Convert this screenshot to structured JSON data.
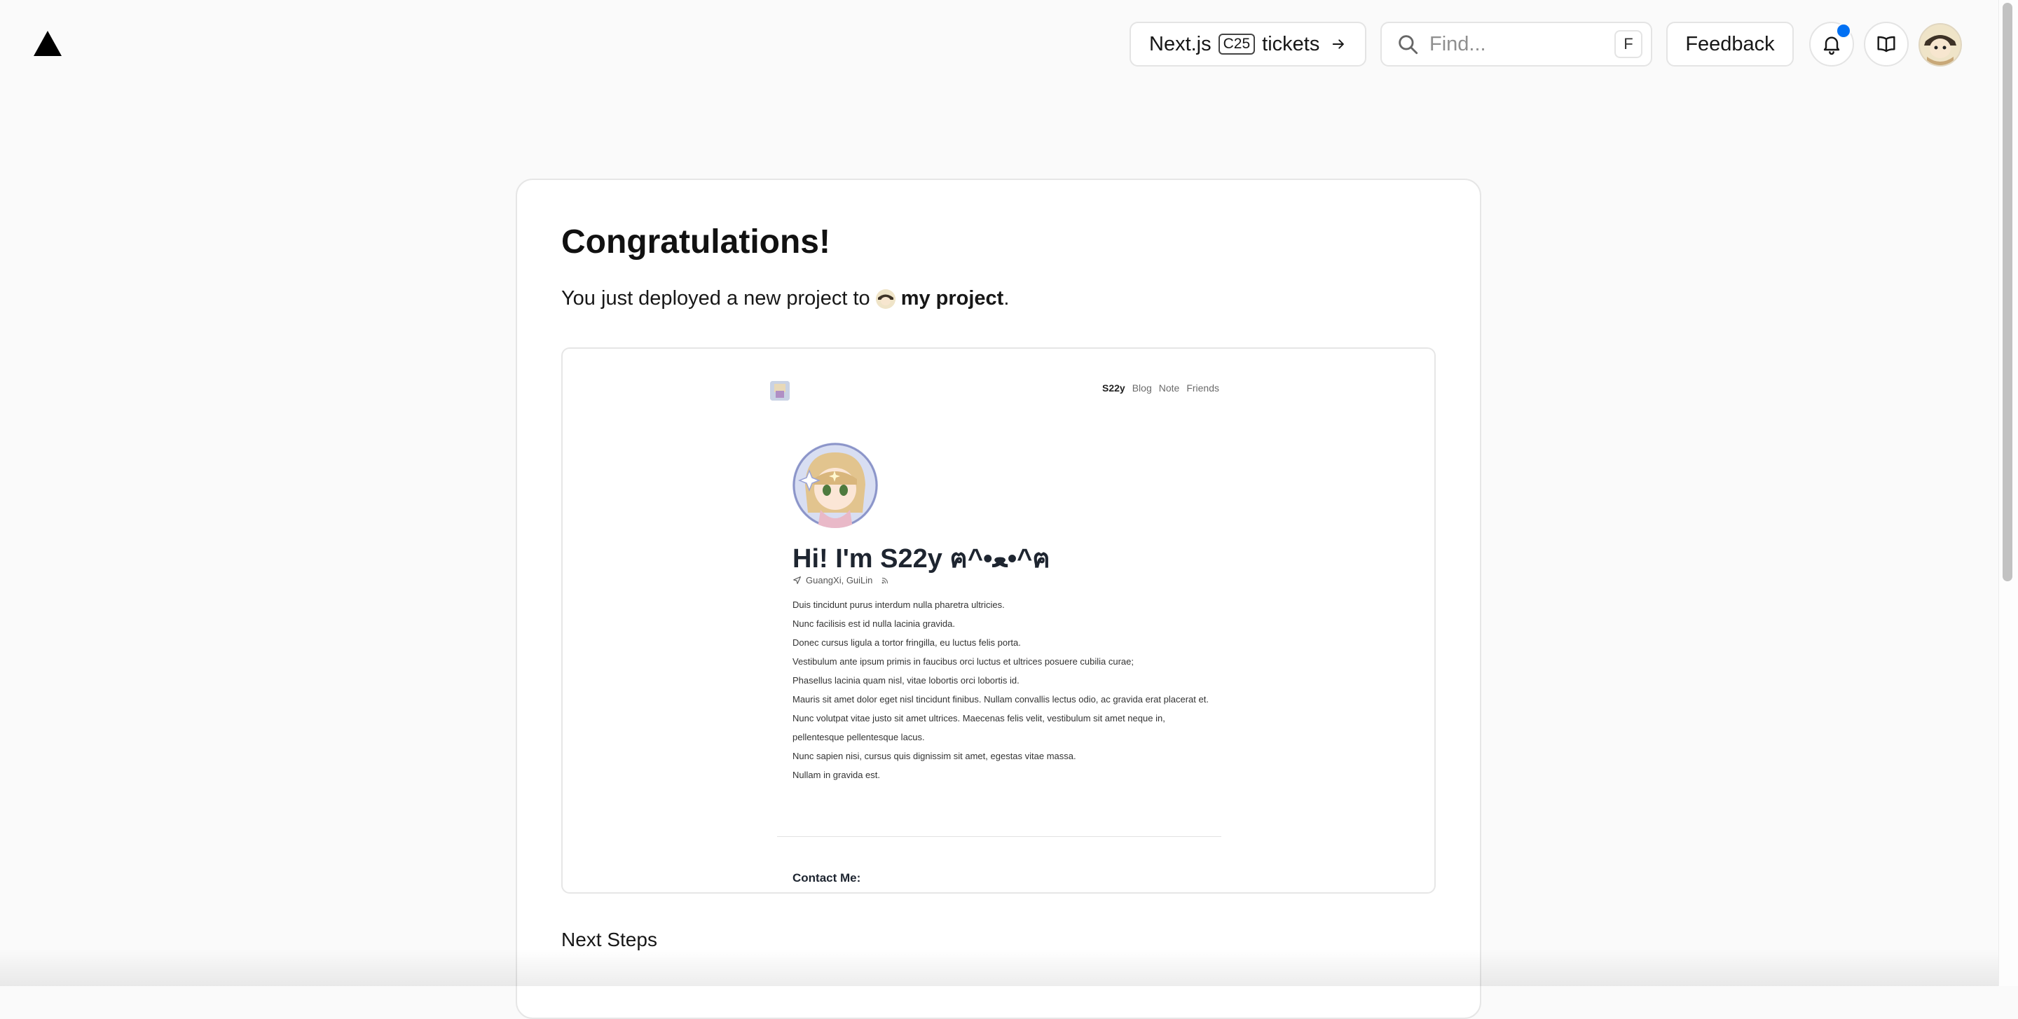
{
  "header": {
    "logo_icon": "vercel-triangle-icon",
    "tickets": {
      "prefix": "Next.js",
      "tag": "C25",
      "suffix": "tickets",
      "icon": "arrow-right-icon"
    },
    "search": {
      "placeholder": "Find...",
      "shortcut": "F",
      "icon": "search-icon"
    },
    "feedback_label": "Feedback",
    "notifications": {
      "icon": "bell-icon",
      "has_unread": true,
      "dot_color": "#0070f3"
    },
    "docs_icon": "book-icon",
    "avatar_icon": "user-avatar"
  },
  "main": {
    "title": "Congratulations!",
    "deploy_prefix": "You just deployed a new project to",
    "team_name": "my project",
    "deploy_suffix": ".",
    "next_steps_label": "Next Steps"
  },
  "preview": {
    "nav": [
      "S22y",
      "Blog",
      "Note",
      "Friends"
    ],
    "hero_title": "Hi! I'm S22y ฅ^•ﻌ•^ฅ",
    "location": "GuangXi, GuiLin",
    "paragraphs": [
      "Duis tincidunt purus interdum nulla pharetra ultricies.",
      "Nunc facilisis est id nulla lacinia gravida.",
      "Donec cursus ligula a tortor fringilla, eu luctus felis porta.",
      "Vestibulum ante ipsum primis in faucibus orci luctus et ultrices posuere cubilia curae;",
      "Phasellus lacinia quam nisl, vitae lobortis orci lobortis id.",
      "Mauris sit amet dolor eget nisl tincidunt finibus. Nullam convallis lectus odio, ac gravida erat placerat et.",
      "Nunc volutpat vitae justo sit amet ultrices. Maecenas felis velit, vestibulum sit amet neque in, pellentesque pellentesque lacus.",
      "Nunc sapien nisi, cursus quis dignissim sit amet, egestas vitae massa.",
      "Nullam in gravida est."
    ],
    "contact_label": "Contact Me:"
  }
}
